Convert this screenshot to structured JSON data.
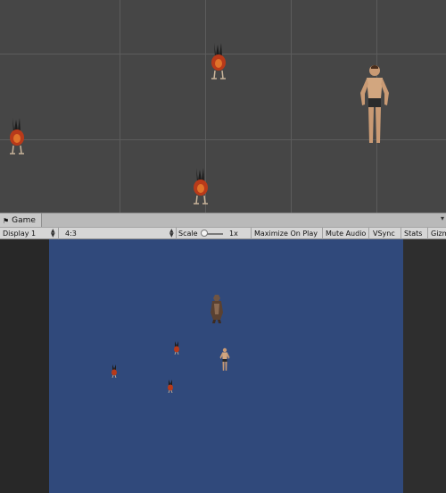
{
  "scene_view": {
    "grid_color": "#5c5c5c",
    "background": "#464646",
    "objects": [
      "bird-creature",
      "bird-creature",
      "bird-creature",
      "human-character"
    ]
  },
  "tabs": {
    "game_icon": "⚑",
    "game_label": "Game",
    "menu_glyph": "▾"
  },
  "toolbar": {
    "display": "Display 1",
    "aspect": "4:3",
    "scale_label": "Scale",
    "scale_value": "1x",
    "maximize": "Maximize On Play",
    "mute": "Mute Audio",
    "vsync": "VSync",
    "stats": "Stats",
    "gizmos": "Gizmos"
  },
  "game_view": {
    "background": "#30497b",
    "objects": [
      "monster-figure",
      "bird-creature",
      "human-character",
      "bird-creature",
      "bird-creature"
    ]
  }
}
